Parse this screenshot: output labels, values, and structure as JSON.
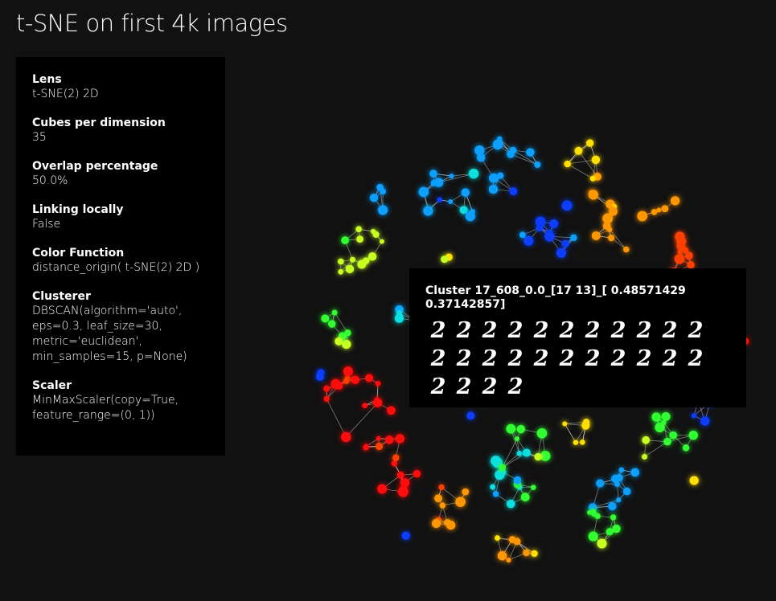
{
  "page": {
    "title": "t-SNE on first 4k images",
    "background": "#111111"
  },
  "info_panel": {
    "sections": [
      {
        "label": "Lens",
        "value": "t-SNE(2) 2D"
      },
      {
        "label": "Cubes per dimension",
        "value": "35"
      },
      {
        "label": "Overlap percentage",
        "value": "50.0%"
      },
      {
        "label": "Linking locally",
        "value": "False"
      },
      {
        "label": "Color Function",
        "value": "distance_origin( t-SNE(2) 2D )"
      },
      {
        "label": "Clusterer",
        "value": "DBSCAN(algorithm='auto',\neps=0.3, leaf_size=30,\nmetric='euclidean',\nmin_samples=15, p=None)"
      },
      {
        "label": "Scaler",
        "value": "MinMaxScaler(copy=True,\nfeature_range=(0, 1))"
      }
    ]
  },
  "tooltip": {
    "title": "Cluster 17_608_0.0_[17 13]_[ 0.48571429 0.37142857]",
    "digits": [
      "2",
      "2",
      "2",
      "2",
      "2",
      "2",
      "2",
      "2",
      "2",
      "2",
      "2",
      "2",
      "2",
      "2",
      "2",
      "2",
      "2",
      "2",
      "2",
      "2",
      "2",
      "2",
      "2",
      "2",
      "2",
      "2"
    ]
  },
  "graph": {
    "color_scale": [
      "#0a3cff",
      "#0aa0ff",
      "#10e0e0",
      "#30ff30",
      "#c8ff20",
      "#ffe000",
      "#ff9800",
      "#ff4000",
      "#ff1010"
    ],
    "edge_color": "#ffffff"
  }
}
